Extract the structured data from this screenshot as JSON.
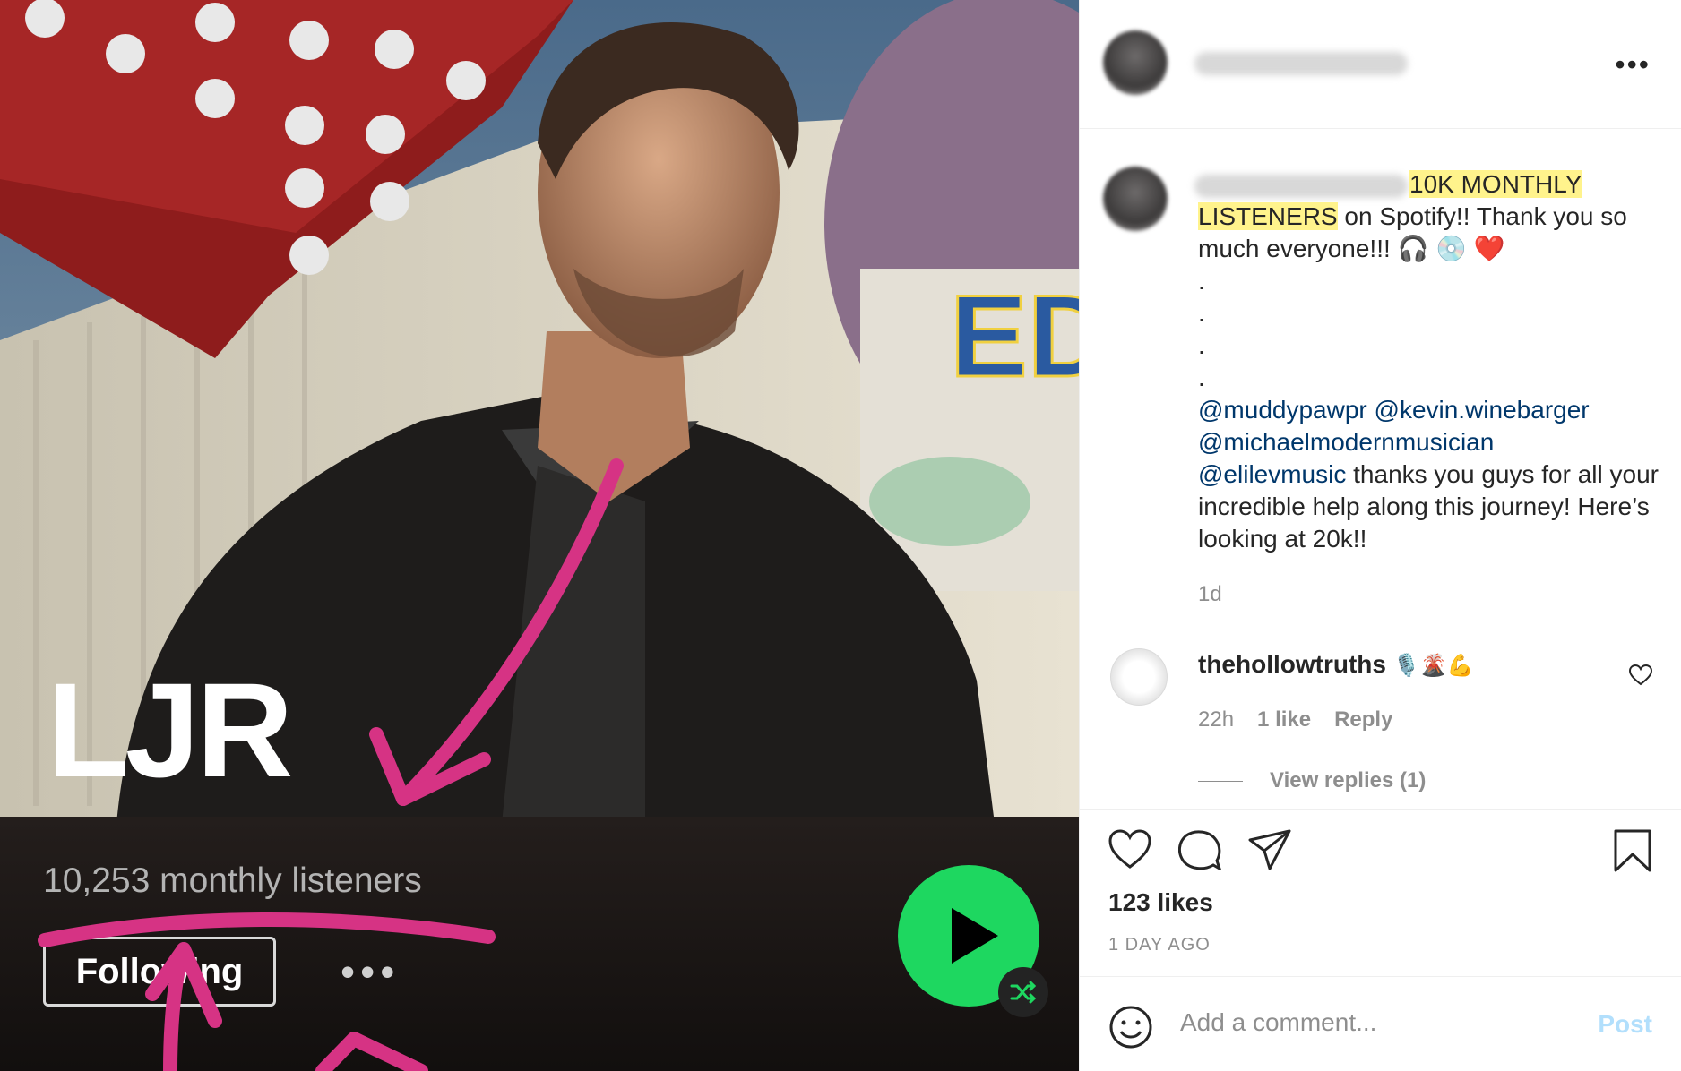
{
  "photo": {
    "artist_name": "LJR",
    "monthly_listeners": "10,253 monthly listeners",
    "follow_label": "Following",
    "more_label": "•••",
    "colors": {
      "spotify_green": "#1ed760",
      "annotation_pink": "#d63384"
    }
  },
  "post": {
    "username": "",
    "caption": {
      "highlight": "10K MONTHLY LISTENERS",
      "text_after": " on Spotify!! Thank you so much everyone!!! 🎧 💿 ❤️",
      "dots": [
        ".",
        ".",
        ".",
        "."
      ],
      "mentions": [
        "@muddypawpr",
        "@kevin.winebarger",
        "@michaelmodernmusician",
        "@elilevmusic"
      ],
      "text_end": " thanks you guys for all your incredible help along this journey! Here’s looking at 20k!!"
    },
    "time": "1d",
    "comment": {
      "username": "thehollowtruths",
      "emoji": "🎙️🌋💪",
      "time": "22h",
      "likes": "1 like",
      "reply": "Reply",
      "view_replies": "View replies (1)"
    },
    "likes": "123 likes",
    "date": "1 DAY AGO",
    "add_comment_placeholder": "Add a comment...",
    "post_label": "Post"
  },
  "icons": [
    "more-options-icon",
    "heart-icon",
    "comment-icon",
    "share-icon",
    "bookmark-icon",
    "emoji-icon",
    "play-icon",
    "shuffle-icon"
  ]
}
